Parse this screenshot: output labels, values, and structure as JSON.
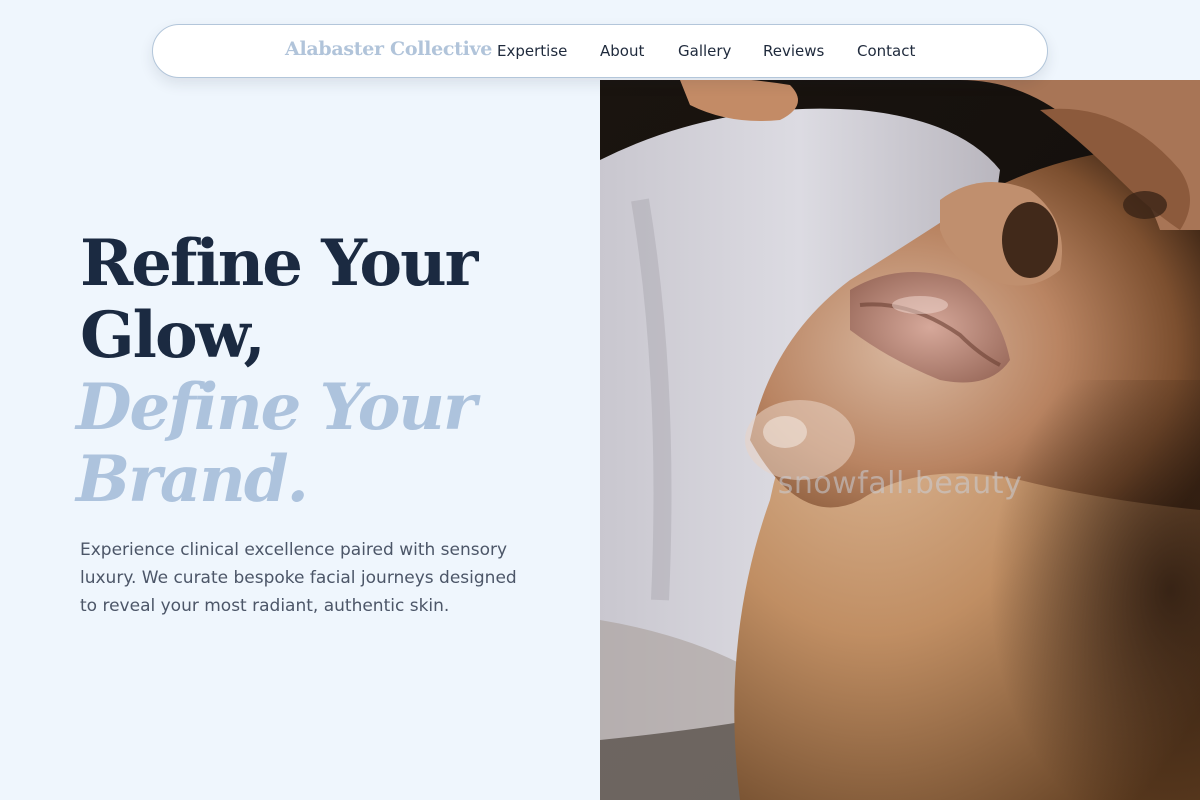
{
  "brand": {
    "name": "Alabaster Collective"
  },
  "nav": {
    "links": [
      {
        "label": "Expertise"
      },
      {
        "label": "About"
      },
      {
        "label": "Gallery"
      },
      {
        "label": "Reviews"
      },
      {
        "label": "Contact"
      }
    ]
  },
  "hero": {
    "title_line1": "Refine Your",
    "title_line2": "Glow,",
    "accent_line1": "Define Your",
    "accent_line2": "Brand.",
    "description": "Experience clinical excellence paired with sensory luxury. We curate bespoke facial journeys designed to reveal your most radiant, authentic skin.",
    "image": {
      "subject": "close-up photo of a face receiving a facial treatment",
      "watermark": "snowfall.beauty"
    }
  },
  "colors": {
    "background": "#eff6fd",
    "heading": "#1b2a41",
    "accent": "#adc3dd",
    "brand": "#b1c4da",
    "body_text": "#4c5668",
    "nav_border": "#b3c6da"
  }
}
